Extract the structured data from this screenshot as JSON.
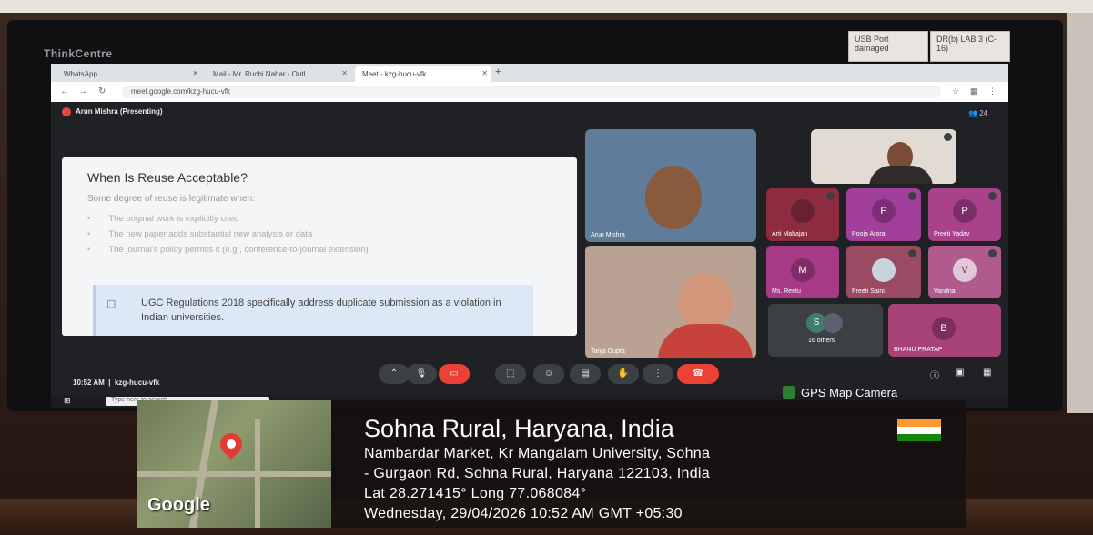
{
  "monitor": {
    "brand": "ThinkCentre",
    "sticky_notes": [
      "USB Port damaged",
      "DR(b) LAB 3 (C-16)"
    ]
  },
  "browser": {
    "tabs": [
      {
        "label": "WhatsApp",
        "active": false
      },
      {
        "label": "Mail - Mr. Ruchi Nahar - Outl...",
        "active": false
      },
      {
        "label": "Meet - kzg-hucu-vfk",
        "active": true
      }
    ],
    "url": "meet.google.com/kzg-hucu-vfk"
  },
  "meet": {
    "presenter": "Arun Mishra (Presenting)",
    "people_count": "24",
    "meeting_time": "10:52 AM",
    "meeting_code": "kzg-hucu-vfk",
    "slide": {
      "title": "When Is Reuse Acceptable?",
      "intro": "Some degree of reuse is legitimate when:",
      "bullets": [
        "The original work is explicitly cited",
        "The new paper adds substantial new analysis or data",
        "The journal's policy permits it (e.g., conference-to-journal extension)"
      ],
      "callout": "UGC Regulations 2018 specifically address duplicate submission as a violation in Indian universities."
    },
    "participants": [
      {
        "name": "Arun Mishra",
        "initial": "",
        "color": "#4d6e8a"
      },
      {
        "name": "Tanja Gupta",
        "initial": "",
        "color": "#b48b78"
      },
      {
        "name": "",
        "initial": "",
        "color": "#d8d0c8"
      },
      {
        "name": "Arti Mahajan",
        "initial": "",
        "color": "#8f2b3f"
      },
      {
        "name": "Pooja Arora",
        "initial": "P",
        "color": "#a23f9b"
      },
      {
        "name": "Preeti Yadav",
        "initial": "P",
        "color": "#a8438a"
      },
      {
        "name": "Ms. Reetu",
        "initial": "M",
        "color": "#a63a86"
      },
      {
        "name": "Preeti Saini",
        "initial": "",
        "color": "#9a4a62"
      },
      {
        "name": "Vandna",
        "initial": "V",
        "color": "#b05a8e"
      },
      {
        "name": "16 others",
        "initial": "S",
        "color": "#3c4043"
      },
      {
        "name": "BHANU PRATAP",
        "initial": "B",
        "color": "#a8437a"
      }
    ]
  },
  "taskbar": {
    "search_placeholder": "Type here to search"
  },
  "gps_stamp": {
    "app_label": "GPS Map Camera",
    "map_brand": "Google",
    "title": "Sohna Rural, Haryana, India",
    "address_line1": "Nambardar Market, Kr Mangalam University, Sohna",
    "address_line2": "- Gurgaon Rd, Sohna Rural, Haryana 122103, India",
    "coords": "Lat 28.271415° Long 77.068084°",
    "datetime": "Wednesday, 29/04/2026 10:52 AM GMT +05:30",
    "flag_colors": [
      "#ff9933",
      "#ffffff",
      "#138808"
    ]
  }
}
